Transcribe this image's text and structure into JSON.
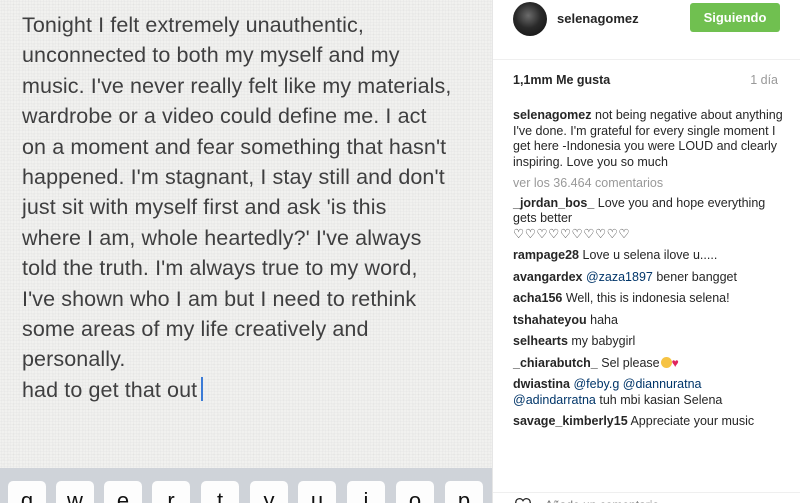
{
  "photo": {
    "note_lines": [
      "Tonight I felt extremely unauthentic,",
      "unconnected to both my myself and my",
      "music. I've never really felt like my materials,",
      "wardrobe or a video could define me. I act",
      "on a moment and fear something that hasn't",
      "happened. I'm stagnant, I stay still and don't",
      "just sit with myself first and ask 'is this",
      "where I am, whole heartedly?' I've always",
      "told the truth. I'm always true to my word,",
      "I've shown who I am but I need to rethink",
      "some areas of my life creatively and",
      "personally.",
      "had to get that out"
    ],
    "keyboard_keys": [
      "q",
      "w",
      "e",
      "r",
      "t",
      "y",
      "u",
      "i",
      "o",
      "p"
    ]
  },
  "post": {
    "username": "selenagomez",
    "follow_label": "Siguiendo",
    "likes": "1,1mm Me gusta",
    "time": "1 día",
    "caption": {
      "user": "selenagomez",
      "text": " not being negative about anything I've done. I'm grateful for every single moment I get here -Indonesia you were LOUD and clearly inspiring. Love you so much"
    },
    "view_all": "ver los 36.464 comentarios",
    "comments": [
      {
        "user": "_jordan_bos_",
        "text": " Love you and hope everything gets better",
        "extra": "♡♡♡♡♡♡♡♡♡♡"
      },
      {
        "user": "rampage28",
        "text": " Love u selena ilove u....."
      },
      {
        "user": "avangardex",
        "mention": "@zaza1897",
        "text": " bener bangget"
      },
      {
        "user": "acha156",
        "text": " Well, this is indonesia selena!"
      },
      {
        "user": "tshahateyou",
        "text": " haha"
      },
      {
        "user": "selhearts",
        "text": " my babygirl"
      },
      {
        "user": "_chiarabutch_",
        "text": " Sel please"
      },
      {
        "user": "dwiastina",
        "mention": "@feby.g",
        "mention2": "@diannuratna",
        "mention3": "@adindarratna",
        "text": " tuh mbi kasian Selena"
      },
      {
        "user": "savage_kimberly15",
        "text": " Appreciate your music"
      }
    ],
    "add_comment_placeholder": "Añade un comentario..."
  },
  "icons": {
    "heart": "heart-outline-icon"
  },
  "colors": {
    "follow_bg": "#70c050",
    "mention": "#003569",
    "muted": "#999999",
    "caret": "#3b7bd6"
  }
}
